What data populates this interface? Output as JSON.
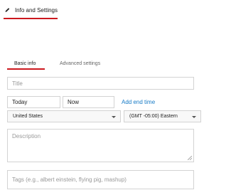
{
  "top_tab": {
    "label": "Info and Settings",
    "icon": "pencil-icon"
  },
  "sub_tabs": [
    {
      "label": "Basic info",
      "active": true
    },
    {
      "label": "Advanced settings",
      "active": false
    }
  ],
  "form": {
    "title_placeholder": "Title",
    "date_value": "Today",
    "time_value": "Now",
    "add_end_time_label": "Add end time",
    "country_value": "United States",
    "timezone_value": "(GMT -05:00) Eastern",
    "description_placeholder": "Description",
    "tags_placeholder": "Tags (e.g., albert einstein, flying pig, mashup)"
  },
  "colors": {
    "accent_red": "#cc181e",
    "link_blue": "#167ac6",
    "border_gray": "#d3d3d3"
  }
}
